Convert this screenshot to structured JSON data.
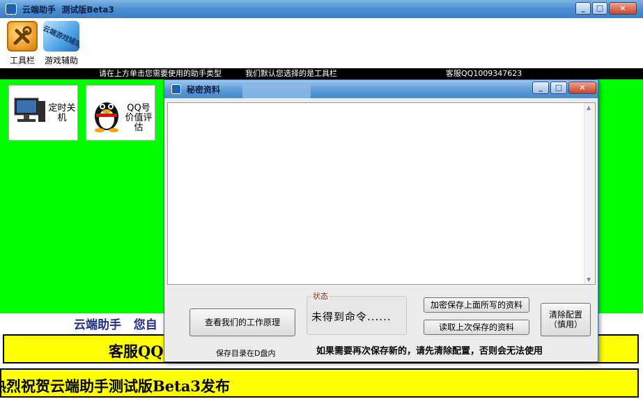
{
  "main_window": {
    "title": "云端助手  测试版Beta3",
    "controls": {
      "minimize": "_",
      "maximize": "□",
      "close": "×"
    },
    "toolbar": [
      {
        "label": "工具栏",
        "icon": "tools-icon"
      },
      {
        "label": "游戏辅助",
        "icon": "game-assist-icon",
        "image_text": "云端游戏辅助"
      }
    ],
    "info_bar": {
      "hint": "请在上方单击您需要使用的助手类型",
      "default_note": "我们默认您选择的是工具栏",
      "service": "客服QQ1009347623"
    },
    "tiles": [
      {
        "label": "定时关机",
        "icon": "computer-icon"
      },
      {
        "label": "QQ号价值评估",
        "icon": "qq-penguin-icon"
      }
    ],
    "bottom_text": "云端助手   您自",
    "banner_service": "客服QQ1",
    "banner_release": "热烈祝贺云端助手测试版Beta3发布"
  },
  "dialog": {
    "title": "秘密资料",
    "controls": {
      "minimize": "_",
      "maximize": "□",
      "close": "×"
    },
    "text_value": "",
    "buttons": {
      "principle": "查看我们的工作原理",
      "encrypt_save": "加密保存上面所写的资料",
      "read_last": "读取上次保存的资料",
      "clear_config": "清除配置\n（慎用）"
    },
    "status": {
      "legend": "状态",
      "value": "未得到命令......"
    },
    "save_dir": "保存目录在D盘内",
    "warning": "如果需要再次保存新的，请先清除配置，否则会无法使用"
  },
  "colors": {
    "green": "#00ff00",
    "yellow": "#ffff00",
    "title_blue": "#4a8fd3"
  }
}
